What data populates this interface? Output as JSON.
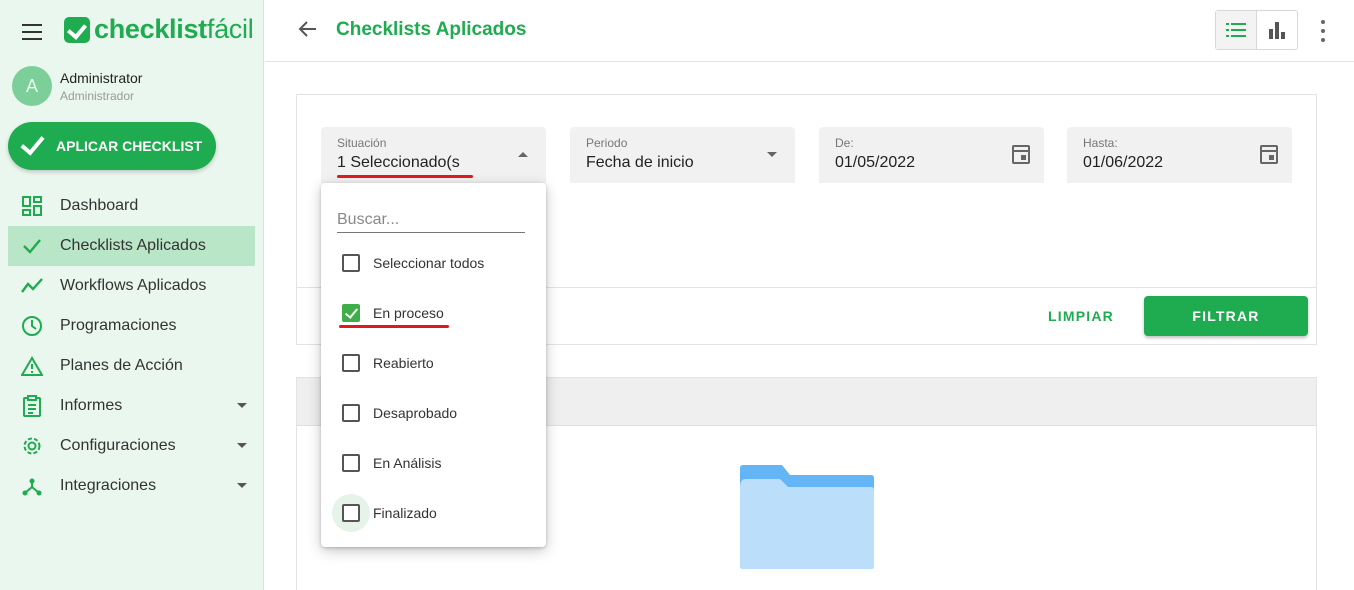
{
  "brand": {
    "logo_bold": "checklist",
    "logo_light": "fácil",
    "color": "#1fab4f"
  },
  "user": {
    "initial": "A",
    "name": "Administrator",
    "role": "Administrador"
  },
  "sidebar": {
    "apply_button": "APLICAR CHECKLIST",
    "items": [
      {
        "label": "Dashboard",
        "icon": "dashboard-icon"
      },
      {
        "label": "Checklists Aplicados",
        "icon": "check-icon",
        "active": true
      },
      {
        "label": "Workflows Aplicados",
        "icon": "trend-icon"
      },
      {
        "label": "Programaciones",
        "icon": "clock-icon"
      },
      {
        "label": "Planes de Acción",
        "icon": "warning-icon"
      },
      {
        "label": "Informes",
        "icon": "report-icon",
        "expandable": true
      },
      {
        "label": "Configuraciones",
        "icon": "gear-icon",
        "expandable": true
      },
      {
        "label": "Integraciones",
        "icon": "integration-icon",
        "expandable": true
      }
    ]
  },
  "header": {
    "title": "Checklists Aplicados"
  },
  "filters": {
    "situation": {
      "label": "Situación",
      "value": "1 Seleccionado(s"
    },
    "period": {
      "label": "Periodo",
      "value": "Fecha de inicio"
    },
    "from": {
      "label": "De:",
      "value": "01/05/2022"
    },
    "to": {
      "label": "Hasta:",
      "value": "01/06/2022"
    },
    "clear": "LIMPIAR",
    "apply": "FILTRAR"
  },
  "dropdown": {
    "search_placeholder": "Buscar...",
    "options": [
      {
        "label": "Seleccionar todos",
        "checked": false
      },
      {
        "label": "En proceso",
        "checked": true
      },
      {
        "label": "Reabierto",
        "checked": false
      },
      {
        "label": "Desaprobado",
        "checked": false
      },
      {
        "label": "En Análisis",
        "checked": false
      },
      {
        "label": "Finalizado",
        "checked": false
      }
    ]
  },
  "colors": {
    "accent": "#1fab4f",
    "sidebar_bg": "#eaf7ee",
    "active_item": "#b8e6c6",
    "annotation": "#e0191f",
    "folder": "#64b5f6"
  }
}
